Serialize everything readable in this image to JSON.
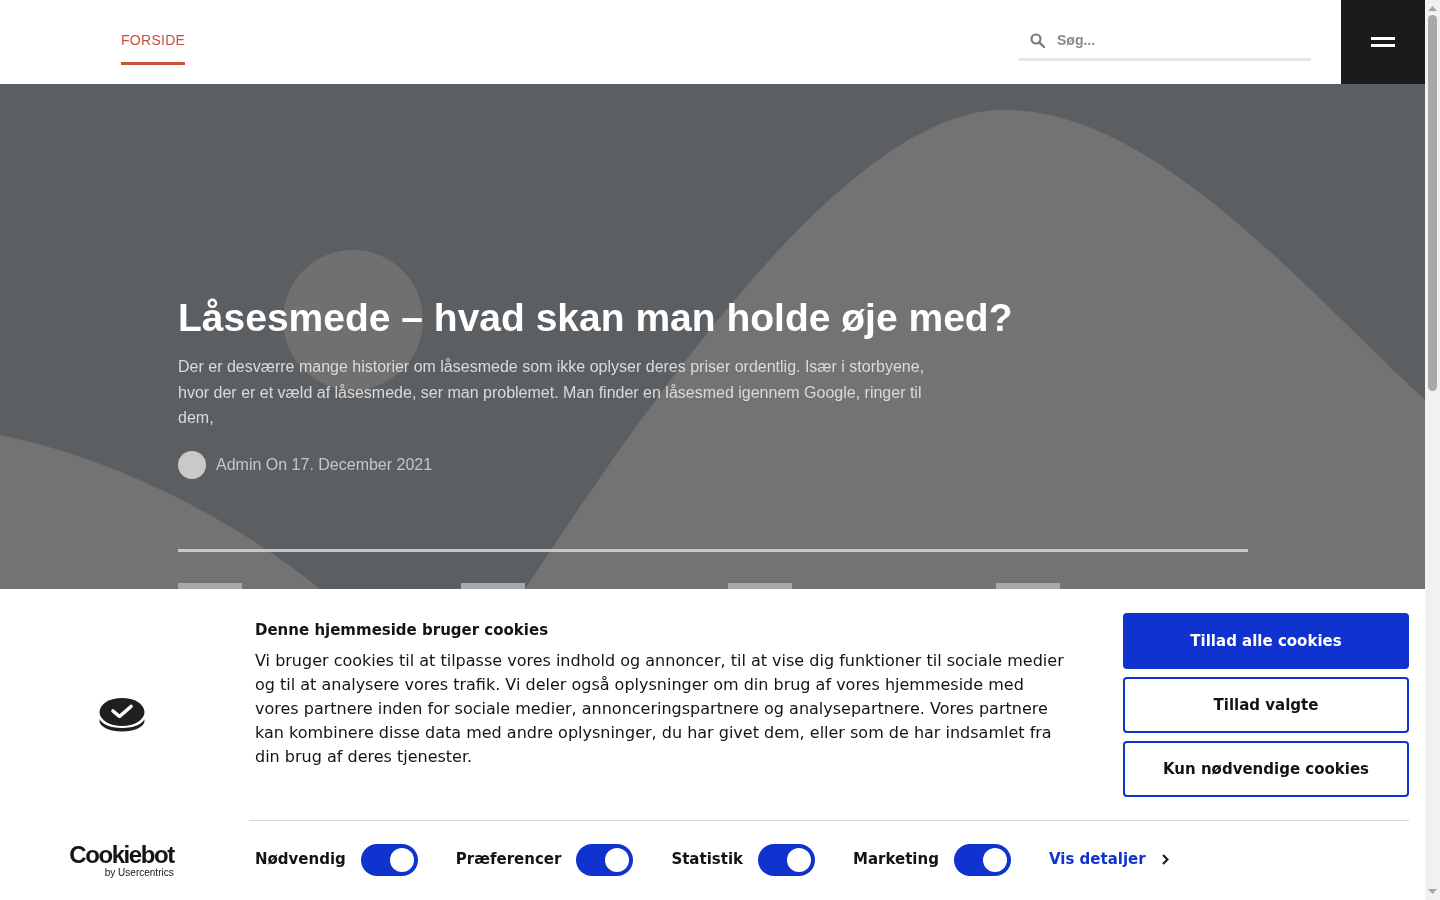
{
  "header": {
    "nav": [
      {
        "label": "FORSIDE",
        "selected": true
      }
    ],
    "search": {
      "placeholder": "Søg..."
    }
  },
  "hero": {
    "title": "Låsesmede – hvad skan man holde øje med?",
    "excerpt": "Der er desværre mange historier om låsesmede som ikke oplyser deres priser ordentlig. Især i storbyene, hvor der er et væld af låsesmede, ser man problemet. Man finder en låsesmed igennem Google, ringer til dem,",
    "meta": "Admin On 17. December 2021"
  },
  "cookie_banner": {
    "title": "Denne hjemmeside bruger cookies",
    "body": "Vi bruger cookies til at tilpasse vores indhold og annoncer, til at vise dig funktioner til sociale medier og til at analysere vores trafik. Vi deler også oplysninger om din brug af vores hjemmeside med vores partnere inden for sociale medier, annonceringspartnere og analysepartnere. Vores partnere kan kombinere disse data med andre oplysninger, du har givet dem, eller som de har indsamlet fra din brug af deres tjenester.",
    "buttons": [
      {
        "label": "Tillad alle cookies",
        "kind": "primary"
      },
      {
        "label": "Tillad valgte",
        "kind": "outline"
      },
      {
        "label": "Kun nødvendige cookies",
        "kind": "outline"
      }
    ],
    "toggles": [
      {
        "label": "Nødvendig",
        "checked": true
      },
      {
        "label": "Præferencer",
        "checked": true
      },
      {
        "label": "Statistik",
        "checked": true
      },
      {
        "label": "Marketing",
        "checked": true
      }
    ],
    "details_link": "Vis detaljer",
    "logo": {
      "name": "Cookiebot",
      "tagline": "by Usercentrics"
    }
  }
}
